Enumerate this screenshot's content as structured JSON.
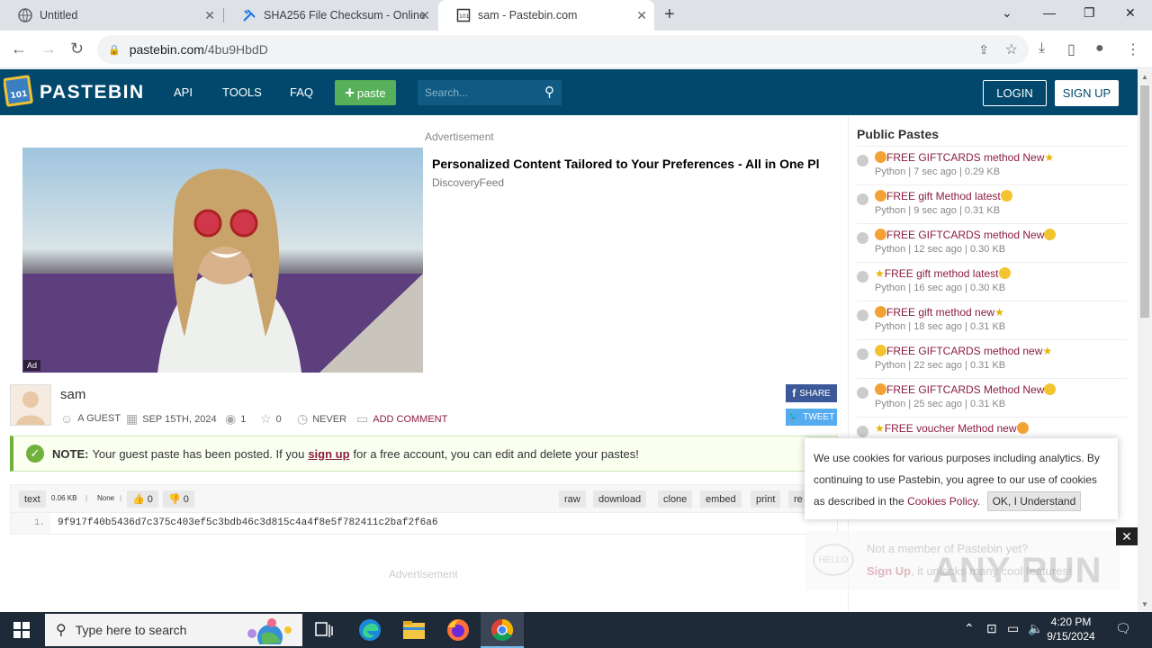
{
  "browser": {
    "tabs": [
      {
        "title": "Untitled",
        "icon": "globe-icon",
        "active": false
      },
      {
        "title": "SHA256 File Checksum - Online",
        "icon": "tools-icon",
        "active": false
      },
      {
        "title": "sam - Pastebin.com",
        "icon": "pastebin-icon",
        "active": true
      }
    ],
    "address": {
      "host": "pastebin.com",
      "path": "/4bu9HbdD"
    }
  },
  "header": {
    "logo_text": "PASTEBIN",
    "nav": [
      "API",
      "TOOLS",
      "FAQ"
    ],
    "paste_button": "paste",
    "search_placeholder": "Search...",
    "login": "LOGIN",
    "signup": "SIGN UP"
  },
  "ad": {
    "label": "Advertisement",
    "title": "Personalized Content Tailored to Your Preferences - All in One Pl",
    "source": "DiscoveryFeed",
    "tag": "Ad",
    "label2": "Advertisement"
  },
  "paste": {
    "title": "sam",
    "author": "A GUEST",
    "date": "SEP 15TH, 2024",
    "views": "1",
    "stars": "0",
    "expire": "NEVER",
    "add_comment": "ADD COMMENT",
    "share": "SHARE",
    "tweet": "TWEET",
    "notice_bold": "NOTE:",
    "notice_pre": "Your guest paste has been posted. If you",
    "notice_link": "sign up",
    "notice_post": "for a free account, you can edit and delete your pastes!",
    "syntax": "text",
    "size": "0.06 KB",
    "category": "None",
    "likes": "0",
    "dislikes": "0",
    "actions": [
      "raw",
      "download",
      "clone",
      "embed",
      "print",
      "re"
    ],
    "line_number": "1.",
    "code": "9f917f40b5436d7c375c403ef5c3bdb46c3d815c4a4f8e5f782411c2baf2f6a6"
  },
  "sidebar": {
    "title": "Public Pastes",
    "items": [
      {
        "title": "FREE GIFTCARDS method New",
        "meta": "Python | 7 sec ago | 0.29 KB"
      },
      {
        "title": "FREE gift Method latest",
        "meta": "Python | 9 sec ago | 0.31 KB"
      },
      {
        "title": "FREE GIFTCARDS method New",
        "meta": "Python | 12 sec ago | 0.30 KB"
      },
      {
        "title": "FREE gift method latest",
        "meta": "Python | 16 sec ago | 0.30 KB"
      },
      {
        "title": "FREE gift method new",
        "meta": "Python | 18 sec ago | 0.31 KB"
      },
      {
        "title": "FREE GIFTCARDS method new",
        "meta": "Python | 22 sec ago | 0.31 KB"
      },
      {
        "title": "FREE GIFTCARDS Method New",
        "meta": "Python | 25 sec ago | 0.31 KB"
      },
      {
        "title": "FREE voucher Method new",
        "meta": ""
      }
    ]
  },
  "cookie": {
    "text1": "We use cookies for various purposes including analytics. By continuing to use Pastebin, you agree to our use of cookies as described in the",
    "link": "Cookies Policy",
    "ok": "OK, I Understand"
  },
  "member": {
    "question": "Not a member of Pastebin yet?",
    "signup": "Sign Up",
    "rest": ", it unlocks many cool features!"
  },
  "watermark": "ANY RUN",
  "taskbar": {
    "search_placeholder": "Type here to search",
    "time": "4:20 PM",
    "date": "9/15/2024"
  },
  "colors": {
    "header_bg": "#02486d",
    "paste_button": "#58b05b",
    "link": "#8b1d3f"
  }
}
